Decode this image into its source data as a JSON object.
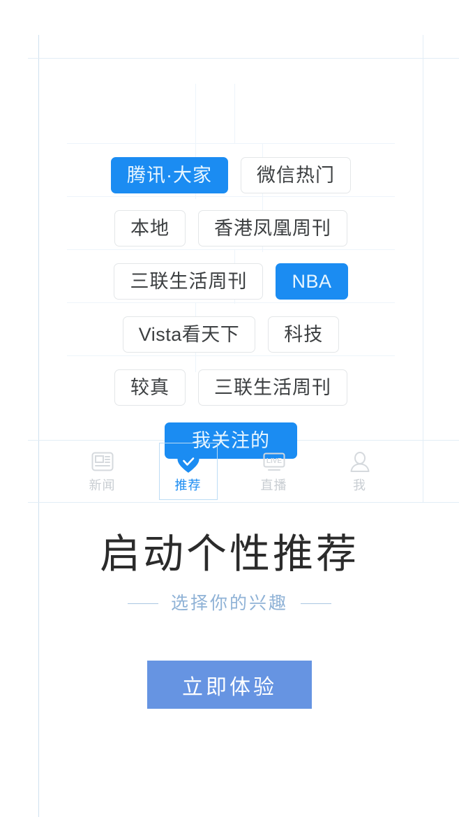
{
  "colors": {
    "accent_blue": "#1b8cf2",
    "cta_blue": "#6694e2",
    "guide_line": "#cfe0ef",
    "tag_border": "#e3e6e8",
    "tab_inactive": "#c8cdd2",
    "subtitle_blue": "#8fb2d6",
    "title_dark": "#2b2b2b"
  },
  "tag_cloud": {
    "rows": [
      {
        "tags": [
          {
            "label": "腾讯·大家",
            "selected": true
          },
          {
            "label": "微信热门",
            "selected": false
          }
        ]
      },
      {
        "tags": [
          {
            "label": "本地",
            "selected": false
          },
          {
            "label": "香港凤凰周刊",
            "selected": false
          }
        ]
      },
      {
        "tags": [
          {
            "label": "三联生活周刊",
            "selected": false
          },
          {
            "label": "NBA",
            "selected": true
          }
        ]
      },
      {
        "tags": [
          {
            "label": "Vista看天下",
            "selected": false
          },
          {
            "label": "科技",
            "selected": false
          }
        ]
      },
      {
        "tags": [
          {
            "label": "较真",
            "selected": false
          },
          {
            "label": "三联生活周刊",
            "selected": false
          }
        ]
      },
      {
        "tags": [
          {
            "label": "我关注的",
            "selected": true
          }
        ]
      }
    ]
  },
  "tab_bar": {
    "items": [
      {
        "label": "新闻",
        "icon": "news-icon",
        "active": false
      },
      {
        "label": "推荐",
        "icon": "heart-check-icon",
        "active": true
      },
      {
        "label": "直播",
        "icon": "live-icon",
        "active": false
      },
      {
        "label": "我",
        "icon": "person-icon",
        "active": false
      }
    ]
  },
  "hero": {
    "title": "启动个性推荐",
    "subtitle": "选择你的兴趣"
  },
  "cta": {
    "label": "立即体验"
  }
}
